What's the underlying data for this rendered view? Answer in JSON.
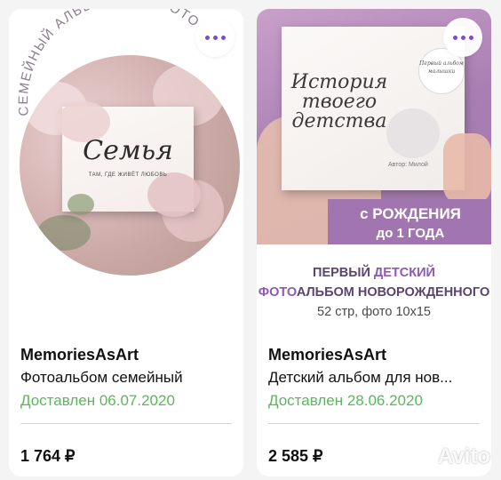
{
  "cards": [
    {
      "photo": {
        "arc_text": "СЕМЕЙНЫЙ АЛЬБОМ ДЛЯ ФОТО",
        "album_title": "Семья",
        "album_subtitle": "ТАМ, ГДЕ ЖИВЁТ ЛЮБОВЬ"
      },
      "seller": "MemoriesAsArt",
      "title": "Фотоальбом семейный",
      "status": "Доставлен 06.07.2020",
      "price": "1 764 ₽"
    },
    {
      "photo": {
        "book_title_1": "История",
        "book_title_2": "твоего",
        "book_title_3": "детства",
        "book_author": "Автор: Милой",
        "badge_text": "Первый альбом малышки",
        "banner_line1": "с РОЖДЕНИЯ",
        "banner_line2": "до 1 ГОДА",
        "caption_line1_a": "ПЕРВЫЙ ",
        "caption_line1_b": "ДЕТСКИЙ",
        "caption_line2_a": "ФОТО",
        "caption_line2_b": "АЛЬБОМ НОВОРОЖДЕННОГО",
        "caption_line3": "52 стр, фото 10х15"
      },
      "seller": "MemoriesAsArt",
      "title": "Детский альбом для нов...",
      "status": "Доставлен 28.06.2020",
      "price": "2 585 ₽"
    }
  ],
  "more_button_icon": "more-dots-icon",
  "watermark_text": "Avito",
  "colors": {
    "status_green": "#58b95a",
    "accent_purple": "#7a4dc9"
  }
}
